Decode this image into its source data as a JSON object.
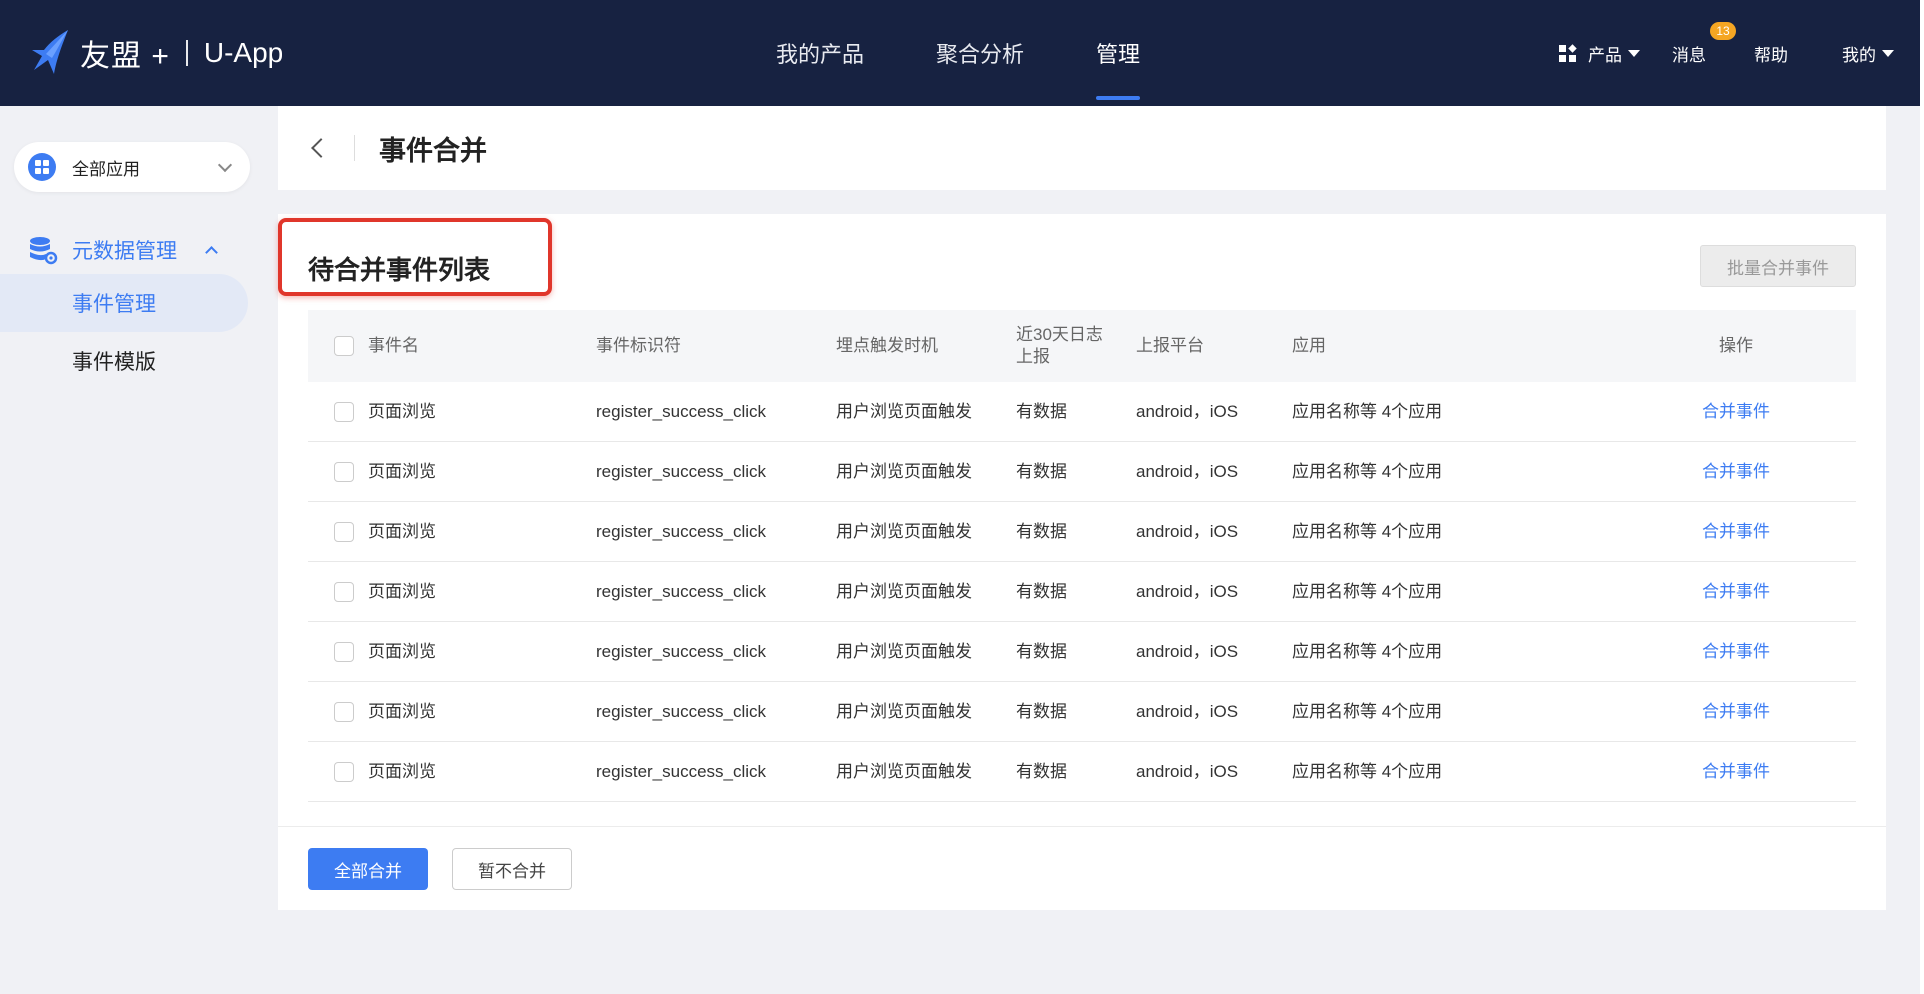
{
  "topbar": {
    "logo_text": "友盟 +",
    "app_name": "U-App",
    "nav": [
      {
        "label": "我的产品"
      },
      {
        "label": "聚合分析"
      },
      {
        "label": "管理"
      }
    ],
    "right": {
      "product_label": "产品",
      "message_label": "消息",
      "message_badge": "13",
      "help_label": "帮助",
      "mine_label": "我的"
    }
  },
  "sidebar": {
    "app_select_label": "全部应用",
    "group_label": "元数据管理",
    "items": [
      {
        "label": "事件管理"
      },
      {
        "label": "事件模版"
      }
    ]
  },
  "header": {
    "title": "事件合并"
  },
  "main": {
    "list_title": "待合并事件列表",
    "batch_button": "批量合并事件",
    "columns": {
      "name": "事件名",
      "id": "事件标识符",
      "trigger": "埋点触发时机",
      "log": "近30天日志上报",
      "platform": "上报平台",
      "app": "应用",
      "op": "操作"
    },
    "rows": [
      {
        "name": "页面浏览",
        "id": "register_success_click",
        "trigger": "用户浏览页面触发",
        "log": "有数据",
        "platform": "android，iOS",
        "app": "应用名称等 4个应用",
        "op": "合并事件"
      },
      {
        "name": "页面浏览",
        "id": "register_success_click",
        "trigger": "用户浏览页面触发",
        "log": "有数据",
        "platform": "android，iOS",
        "app": "应用名称等 4个应用",
        "op": "合并事件"
      },
      {
        "name": "页面浏览",
        "id": "register_success_click",
        "trigger": "用户浏览页面触发",
        "log": "有数据",
        "platform": "android，iOS",
        "app": "应用名称等 4个应用",
        "op": "合并事件"
      },
      {
        "name": "页面浏览",
        "id": "register_success_click",
        "trigger": "用户浏览页面触发",
        "log": "有数据",
        "platform": "android，iOS",
        "app": "应用名称等 4个应用",
        "op": "合并事件"
      },
      {
        "name": "页面浏览",
        "id": "register_success_click",
        "trigger": "用户浏览页面触发",
        "log": "有数据",
        "platform": "android，iOS",
        "app": "应用名称等 4个应用",
        "op": "合并事件"
      },
      {
        "name": "页面浏览",
        "id": "register_success_click",
        "trigger": "用户浏览页面触发",
        "log": "有数据",
        "platform": "android，iOS",
        "app": "应用名称等 4个应用",
        "op": "合并事件"
      },
      {
        "name": "页面浏览",
        "id": "register_success_click",
        "trigger": "用户浏览页面触发",
        "log": "有数据",
        "platform": "android，iOS",
        "app": "应用名称等 4个应用",
        "op": "合并事件"
      }
    ],
    "merge_all_button": "全部合并",
    "skip_button": "暂不合并"
  },
  "colors": {
    "topbar_bg": "#172241",
    "accent": "#3d7cf2",
    "highlight_box": "#e0362b",
    "badge": "#f5a623"
  }
}
